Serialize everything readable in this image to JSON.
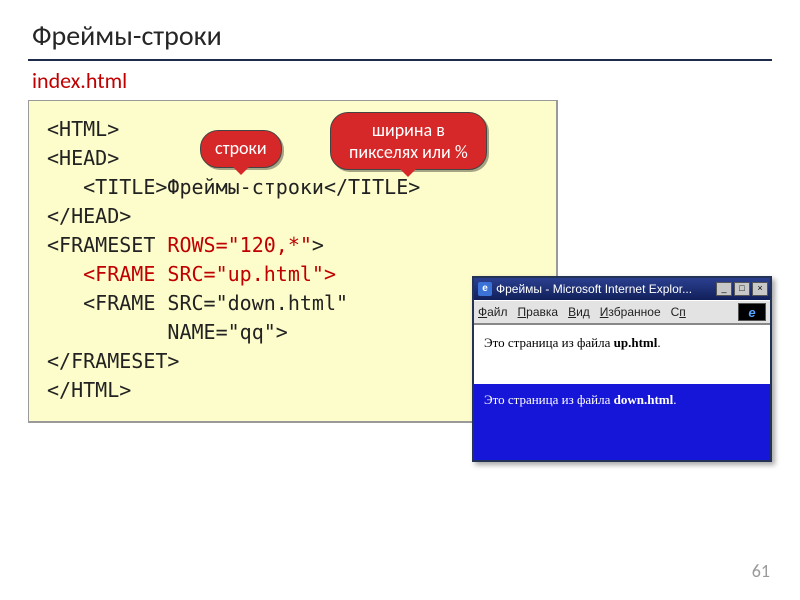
{
  "slide_title": "Фреймы-строки",
  "filename": "index.html",
  "callout1": "строки",
  "callout2_l1": "ширина в",
  "callout2_l2": "пикселях или %",
  "code": {
    "l1": "<HTML>",
    "l2": "<HEAD>",
    "l3a": "   <TITLE>",
    "l3b": "Фреймы-строки",
    "l3c": "</TITLE>",
    "l4": "</HEAD>",
    "l5a": "<FRAMESET ",
    "l5b": "ROWS=\"120,*\"",
    "l5c": ">",
    "l6": "   <FRAME SRC=\"up.html\">",
    "l7": "   <FRAME SRC=\"down.html\"",
    "l8": "          NAME=\"qq\">",
    "l9": "</FRAMESET>",
    "l10": "</HTML>"
  },
  "browser": {
    "title": "Фреймы - Microsoft Internet Explor...",
    "menu": {
      "file": "Файл",
      "edit": "Правка",
      "view": "Вид",
      "fav": "Избранное",
      "more": "Сп"
    },
    "top_prefix": "Это страница из файла ",
    "top_bold": "up.html",
    "bottom_prefix": "Это страница из файла ",
    "bottom_bold": "down.html"
  },
  "page_num": "61"
}
